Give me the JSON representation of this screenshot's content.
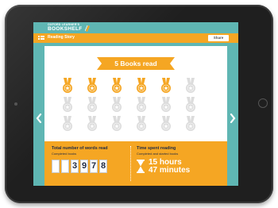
{
  "app": {
    "logo_small": "OXFORD LEARNER'S",
    "logo_big": "BOOKSHELF",
    "title": "Reading Story",
    "share_label": "Share"
  },
  "banner": {
    "text": "5 Books read"
  },
  "medals": {
    "earned": 5,
    "total": 18,
    "per_row": 6
  },
  "stats": {
    "words": {
      "heading": "Total number of words read",
      "subheading": "Completed books",
      "digits": [
        "",
        "",
        "3",
        "9",
        "7",
        "8"
      ]
    },
    "time": {
      "heading": "Time spent reading",
      "subheading": "Completed and started books",
      "hours": "15 hours",
      "minutes": "47 minutes"
    }
  },
  "colors": {
    "teal": "#5fb6b3",
    "orange": "#f5a623",
    "medal_inactive": "#dcdcdc",
    "navy": "#1f2a44"
  },
  "icons": {
    "menu": "menu-icon",
    "prev": "chevron-left-icon",
    "next": "chevron-right-icon",
    "medal": "medal-icon",
    "hourglass": "hourglass-icon",
    "logo": "book-logo-icon"
  }
}
